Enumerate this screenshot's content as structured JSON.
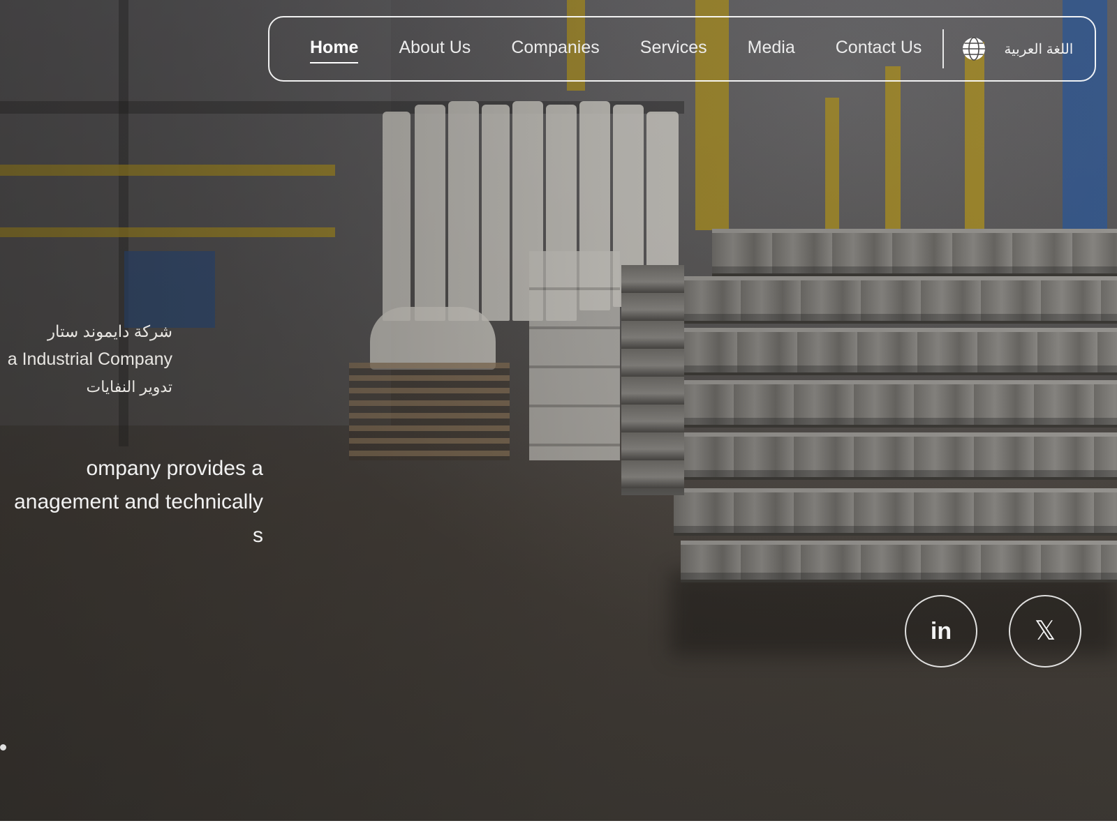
{
  "nav": {
    "items": [
      {
        "label": "Home",
        "active": true
      },
      {
        "label": "About Us",
        "active": false
      },
      {
        "label": "Companies",
        "active": false
      },
      {
        "label": "Services",
        "active": false
      },
      {
        "label": "Media",
        "active": false
      },
      {
        "label": "Contact Us",
        "active": false
      }
    ],
    "language_label": "اللغة العربية",
    "language_icon": "globe-icon"
  },
  "logo": {
    "arabic_line": "شركة دايموند ستار",
    "english_line": "a Industrial Company",
    "arabic_subline": "تدوير النفايات"
  },
  "tagline": {
    "lines": [
      "ompany provides a",
      "anagement and technically",
      "s"
    ]
  },
  "social": {
    "linkedin_label": "in",
    "x_label": "𝕏"
  },
  "colors": {
    "text": "#ffffff",
    "border": "#ffffff",
    "overlay": "#3c3833"
  }
}
